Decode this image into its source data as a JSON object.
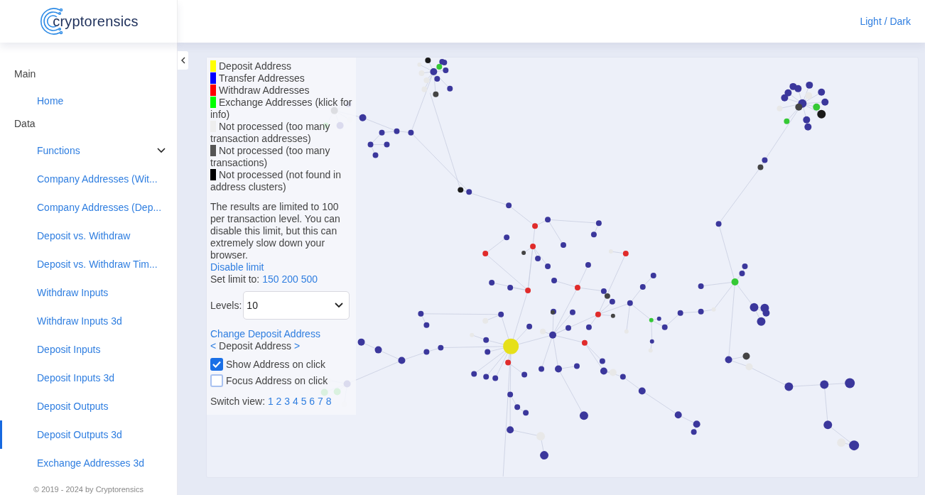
{
  "logo": {
    "text": "cryptorensics"
  },
  "header": {
    "theme_toggle": "Light / Dark"
  },
  "sidebar": {
    "sections": [
      {
        "title": "Main",
        "items": [
          {
            "label": "Home",
            "selected": false
          }
        ]
      },
      {
        "title": "Data",
        "items": [
          {
            "label": "Functions",
            "selected": false,
            "expanded": true,
            "children": [
              {
                "label": "Company Addresses (Wit...",
                "selected": false
              },
              {
                "label": "Company Addresses (Dep...",
                "selected": false
              },
              {
                "label": "Deposit vs. Withdraw",
                "selected": false
              },
              {
                "label": "Deposit vs. Withdraw Tim...",
                "selected": false
              },
              {
                "label": "Withdraw Inputs",
                "selected": false
              },
              {
                "label": "Withdraw Inputs 3d",
                "selected": false
              },
              {
                "label": "Deposit Inputs",
                "selected": false
              },
              {
                "label": "Deposit Inputs 3d",
                "selected": false
              },
              {
                "label": "Deposit Outputs",
                "selected": false
              },
              {
                "label": "Deposit Outputs 3d",
                "selected": true
              },
              {
                "label": "Exchange Addresses 3d",
                "selected": false
              }
            ]
          }
        ]
      }
    ],
    "footer": "© 2019 - 2024 by Cryptorensics"
  },
  "legend": [
    {
      "label": "Deposit Address",
      "color": "#ffff00"
    },
    {
      "label": "Transfer Addresses",
      "color": "#0000ff"
    },
    {
      "label": "Withdraw Addresses",
      "color": "#ff0000"
    },
    {
      "label": "Exchange Addresses (klick for info)",
      "color": "#00ff00"
    },
    {
      "label": "Not processed (too many transaction addresses)",
      "color": "#eeeeee"
    },
    {
      "label": "Not processed (too many transactions)",
      "color": "#555555"
    },
    {
      "label": "Not processed (not found in address clusters)",
      "color": "#000000"
    }
  ],
  "notice": "The results are limited to 100 per transaction level. You can disable this limit, but this can extremely slow down your browser.",
  "disable_limit": "Disable limit",
  "set_limit": {
    "label": "Set limit to:",
    "options": [
      "150",
      "200",
      "500"
    ]
  },
  "levels": {
    "label": "Levels:",
    "value": "10"
  },
  "change_deposit": "Change Deposit Address",
  "deposit_nav": {
    "prev": "<",
    "label": "Deposit Address",
    "next": ">"
  },
  "checkboxes": [
    {
      "label": "Show Address on click",
      "checked": true
    },
    {
      "label": "Focus Address on click",
      "checked": false
    }
  ],
  "switch_view": {
    "label": "Switch view:",
    "options": [
      "1",
      "2",
      "3",
      "4",
      "5",
      "6",
      "7",
      "8"
    ]
  }
}
